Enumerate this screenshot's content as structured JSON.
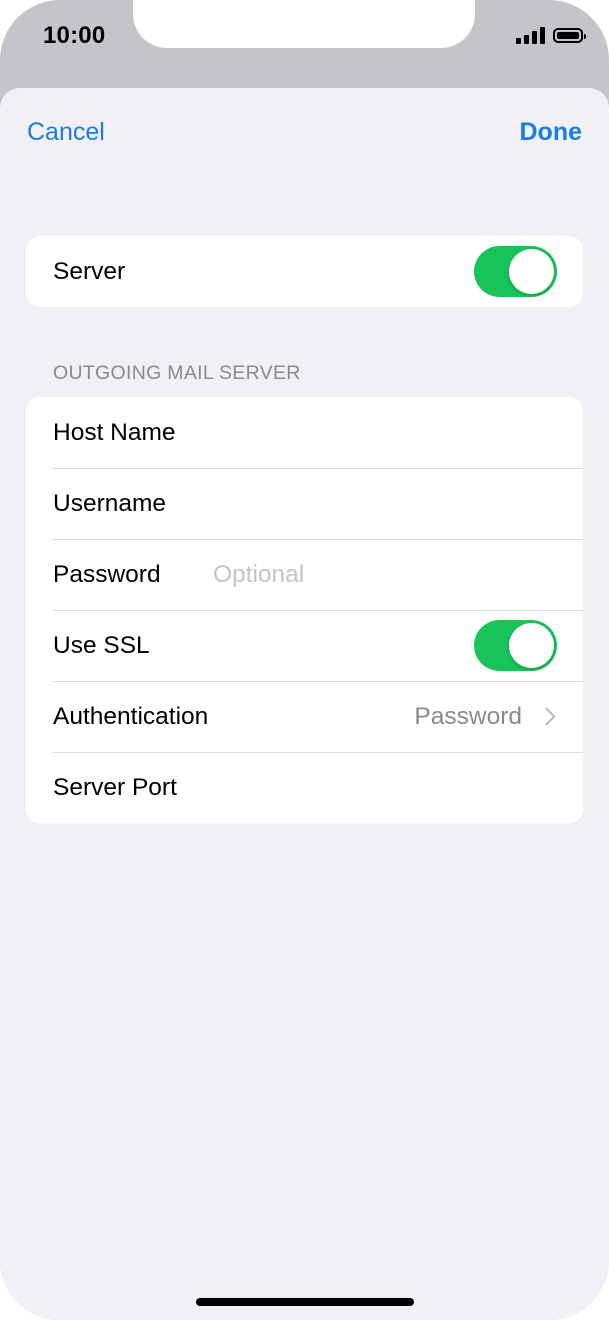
{
  "status_bar": {
    "time": "10:00"
  },
  "nav": {
    "cancel_label": "Cancel",
    "done_label": "Done"
  },
  "server_group": {
    "server_label": "Server",
    "server_enabled": true
  },
  "outgoing": {
    "header": "OUTGOING MAIL SERVER",
    "host_name_label": "Host Name",
    "username_label": "Username",
    "password_label": "Password",
    "password_placeholder": "Optional",
    "use_ssl_label": "Use SSL",
    "use_ssl_enabled": true,
    "authentication_label": "Authentication",
    "authentication_value": "Password",
    "server_port_label": "Server Port"
  },
  "colors": {
    "accent": "#1a7ee6",
    "toggle_on": "#18c45a"
  }
}
